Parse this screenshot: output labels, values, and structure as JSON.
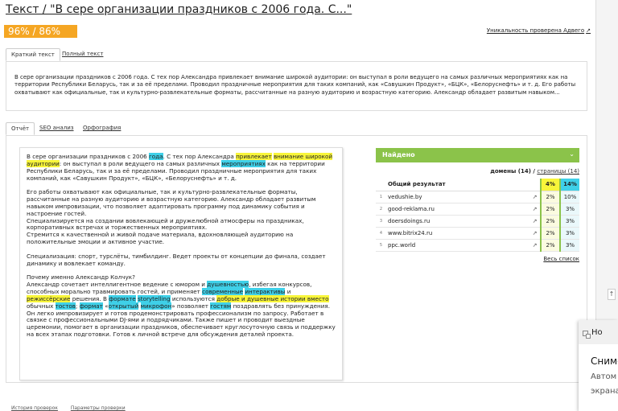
{
  "header": {
    "title": "Текст / \"В сере организации праздников с 2006 года. С...\"",
    "score": "96% / 86%",
    "uniqueness_link": "Уникальность проверена Адвего"
  },
  "text_tabs": [
    "Краткий текст",
    "Полный текст"
  ],
  "short_text": "В сере организации праздников с 2006 года. С тех пор Александра привлекает внимание широкой аудитории: он выступал в роли ведущего на самых различных мероприятиях как на территории Республики Беларусь, так и за её пределами. Проводил праздничные мероприятия для таких компаний, как «Савушкин Продукт», «БЦК», «Белоруснефть» и т. д. Его работы охватывают как официальные, так и культурно-развлекательные форматы, рассчитанные на разную аудиторию и возрастную категорию. Александр обладает развитым навыком...",
  "report_tabs": [
    "Отчёт",
    "SEO анализ",
    "Орфография"
  ],
  "report": {
    "p1": {
      "t1": "В сере организации праздников с 2006 ",
      "h1": "года",
      "t2": ". С тех пор Александра ",
      "h2": "привлекает",
      "t3": " ",
      "h3": "внимание широкой аудитории",
      "t4": ": он выступал в роли ведущего на самых различных ",
      "h4": "мероприятиях",
      "t5": " как на территории Республики Беларусь, так и за её пределами. Проводил праздничные мероприятия для таких компаний, как «Савушкин Продукт», «БЦК», «Белоруснефть» и т. д."
    },
    "p2": "Его работы охватывают как официальные, так и культурно-развлекательные форматы, рассчитанные на разную аудиторию и возрастную категорию. Александр обладает развитым навыком импровизации, что позволяет адаптировать программу под динамику события и настроение гостей.",
    "p2b": "Специализируется на создании вовлекающей и дружелюбной атмосферы на праздниках, корпоративных встречах и торжественных мероприятиях.",
    "p2c": "Стремится к качественной и живой подаче материала, вдохновляющей аудиторию на положительные эмоции и активное участие.",
    "p3": "Специализация: спорт, турслёты, тимбилдинг. Ведет проекты от концепции до финала, создает динамику и вовлекает команду.",
    "p4": {
      "q": "Почему именно Александр Колчук?",
      "t1": "Александр сочетает интеллигентное ведение с юмором и ",
      "h1": "душевностью",
      "t2": ", избегая конкурсов, способных морально травмировать гостей, и применяет ",
      "h2": "современные",
      "t3": " ",
      "h3": "интерактивы",
      "t4": " и ",
      "h4": "режиссёрские",
      "t5": " решения. В ",
      "h5": "формате",
      "t6": " ",
      "h6": "storytelling",
      "t7": " используются ",
      "h7": "добрые и душевные истории вместо",
      "t8": " обычных ",
      "h8": "тостов",
      "t9": "; ",
      "h9": "формат",
      "t10": " «",
      "h10": "открытый",
      "t11": " ",
      "h11": "микрофон",
      "t12": "» позволяет ",
      "h12": "гостям",
      "t13": " поздравлять без принуждения. Он легко импровизирует и готов продемонстрировать профессионализм по запросу. Работает в связке с профессиональными DJ-ями и подрядчиками. Также пишет и проводит выездные церемонии, помогает в организации праздников, обеспечивает круглосуточную связь и поддержку на всех этапах подготовки. Готов к личной встрече для обсуждения деталей проекта."
    }
  },
  "found": {
    "header": "Найдено",
    "domains_label": "домены (14) / ",
    "pages_link": "страницы (14)",
    "total_label": "Общий результат",
    "total_p1": "4%",
    "total_p2": "14%",
    "rows": [
      {
        "n": "1",
        "domain": "vedushie.by",
        "p1": "2%",
        "p2": "10%"
      },
      {
        "n": "2",
        "domain": "good-reklama.ru",
        "p1": "2%",
        "p2": "3%"
      },
      {
        "n": "3",
        "domain": "doersdoings.ru",
        "p1": "2%",
        "p2": "3%"
      },
      {
        "n": "4",
        "domain": "www.bitrix24.ru",
        "p1": "2%",
        "p2": "3%"
      },
      {
        "n": "5",
        "domain": "ppc.world",
        "p1": "2%",
        "p2": "3%"
      }
    ],
    "all_link": "Весь список"
  },
  "bottom_tabs": [
    "История проверок",
    "Параметры проверки"
  ],
  "notification": {
    "app": "Но",
    "title": "Снимо",
    "line1": "Автом",
    "line2": "экрана"
  },
  "colors": {
    "score_bg": "#f5a623",
    "found_header": "#8bc34a",
    "highlight_yellow": "#f8f53a",
    "highlight_blue": "#3fd0e8"
  },
  "icons": [
    "external-link-icon",
    "chevron-down-icon",
    "up-arrow-icon",
    "snipping-tool-icon"
  ]
}
